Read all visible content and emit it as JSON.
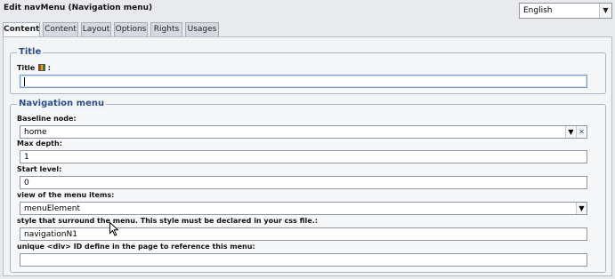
{
  "window": {
    "title": "Edit navMenu (Navigation menu)"
  },
  "language": {
    "selected": "English"
  },
  "tabs": [
    {
      "label": "Content",
      "active": true
    },
    {
      "label": "Content",
      "active": false
    },
    {
      "label": "Layout",
      "active": false
    },
    {
      "label": "Options",
      "active": false
    },
    {
      "label": "Rights",
      "active": false
    },
    {
      "label": "Usages",
      "active": false
    }
  ],
  "title_section": {
    "legend": "Title",
    "field_label": "Title",
    "field_suffix": ":",
    "field_value": ""
  },
  "nav_section": {
    "legend": "Navigation menu",
    "fields": [
      {
        "label": "Baseline node:",
        "value": "home"
      },
      {
        "label": "Max depth:",
        "value": "1"
      },
      {
        "label": "Start level:",
        "value": "0"
      },
      {
        "label": "view of the menu items:",
        "value": "menuElement"
      },
      {
        "label": "style that surround the menu. This style must be declared in your css file.:",
        "value": "navigationN1"
      },
      {
        "label": "unique <div> ID define in the page to reference this menu:",
        "value": ""
      }
    ]
  }
}
